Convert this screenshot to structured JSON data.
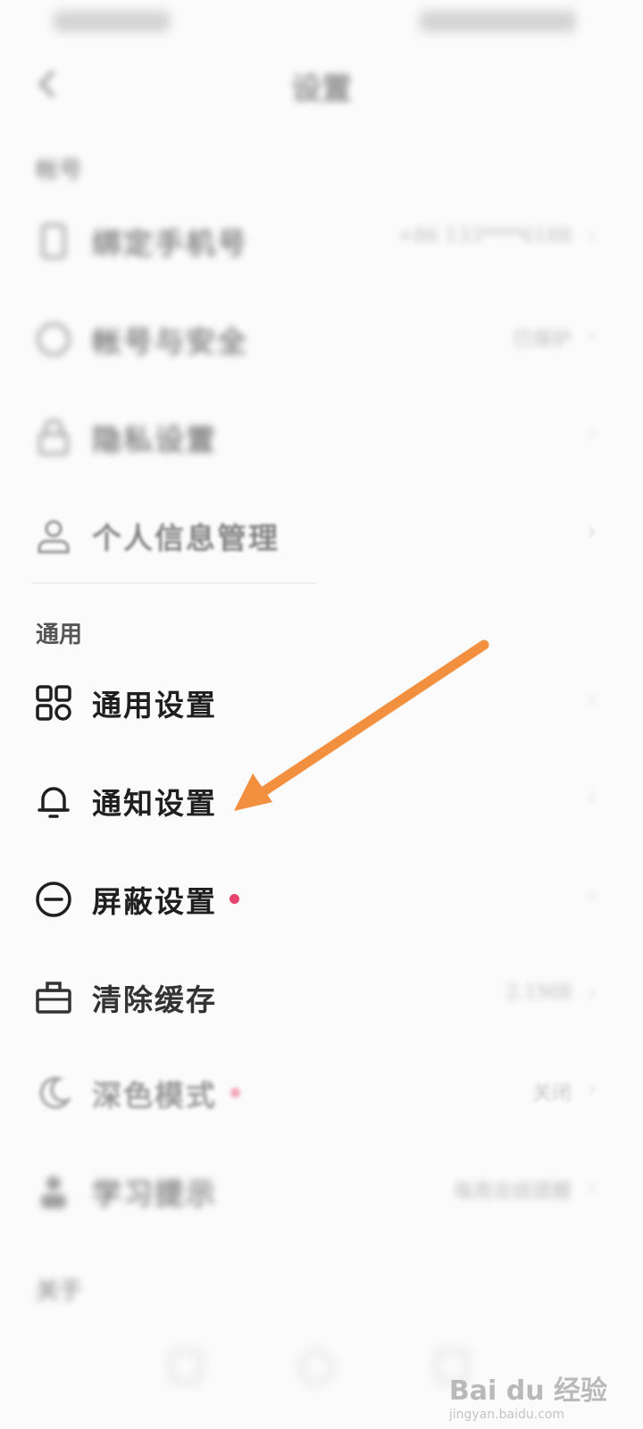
{
  "header": {
    "title": "设置"
  },
  "sections": {
    "account": {
      "title": "帐号"
    },
    "general": {
      "title": "通用"
    },
    "about": {
      "title": "关于"
    }
  },
  "rows": {
    "bind_phone": {
      "label": "绑定手机号",
      "value": "+86 133****6188",
      "icon": "phone-icon"
    },
    "account_security": {
      "label": "帐号与安全",
      "value": "已保护",
      "icon": "shield-icon"
    },
    "privacy": {
      "label": "隐私设置",
      "value": "",
      "icon": "lock-icon"
    },
    "personal_info": {
      "label": "个人信息管理",
      "value": "",
      "icon": "user-icon"
    },
    "general_settings": {
      "label": "通用设置",
      "value": "",
      "icon": "grid-icon"
    },
    "notification_settings": {
      "label": "通知设置",
      "value": "",
      "icon": "bell-icon"
    },
    "block_settings": {
      "label": "屏蔽设置",
      "value": "",
      "icon": "minus-circle-icon",
      "badge": true
    },
    "clear_cache": {
      "label": "清除缓存",
      "value": "2.1MB",
      "icon": "toolbox-icon"
    },
    "dark_mode": {
      "label": "深色模式",
      "value": "关闭",
      "icon": "moon-icon",
      "badge": true
    },
    "study_reminder": {
      "label": "学习提示",
      "value": "每周总结提醒",
      "icon": "person-icon"
    }
  },
  "watermark": {
    "main": "Bai du 经验",
    "sub": "jingyan.baidu.com"
  },
  "colors": {
    "badge": "#e8436a",
    "arrow": "#f39040"
  }
}
